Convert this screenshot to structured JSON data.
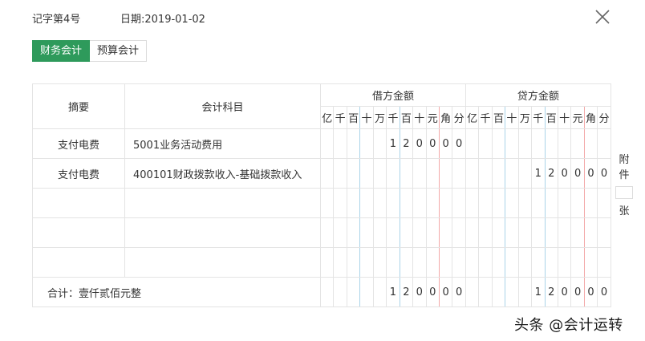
{
  "header": {
    "voucher_no": "记字第4号",
    "date": "日期:2019-01-02"
  },
  "tabs": [
    {
      "label": "财务会计",
      "active": true
    },
    {
      "label": "预算会计",
      "active": false
    }
  ],
  "table": {
    "col_summary": "摘要",
    "col_account": "会计科目",
    "debit_title": "借方金额",
    "credit_title": "贷方金额",
    "units": [
      "亿",
      "千",
      "百",
      "十",
      "万",
      "千",
      "百",
      "十",
      "元",
      "角",
      "分"
    ],
    "rows": [
      {
        "summary": "支付电费",
        "account": "5001业务活动费用",
        "debit": [
          "",
          "",
          "",
          "",
          "",
          "1",
          "2",
          "0",
          "0",
          "0",
          "0"
        ],
        "credit": [
          "",
          "",
          "",
          "",
          "",
          "",
          "",
          "",
          "",
          "",
          ""
        ]
      },
      {
        "summary": "支付电费",
        "account": "400101财政拨款收入-基础拨款收入",
        "debit": [
          "",
          "",
          "",
          "",
          "",
          "",
          "",
          "",
          "",
          "",
          ""
        ],
        "credit": [
          "",
          "",
          "",
          "",
          "",
          "1",
          "2",
          "0",
          "0",
          "0",
          "0"
        ]
      },
      {
        "summary": "",
        "account": "",
        "debit": [
          "",
          "",
          "",
          "",
          "",
          "",
          "",
          "",
          "",
          "",
          ""
        ],
        "credit": [
          "",
          "",
          "",
          "",
          "",
          "",
          "",
          "",
          "",
          "",
          ""
        ]
      },
      {
        "summary": "",
        "account": "",
        "debit": [
          "",
          "",
          "",
          "",
          "",
          "",
          "",
          "",
          "",
          "",
          ""
        ],
        "credit": [
          "",
          "",
          "",
          "",
          "",
          "",
          "",
          "",
          "",
          "",
          ""
        ]
      },
      {
        "summary": "",
        "account": "",
        "debit": [
          "",
          "",
          "",
          "",
          "",
          "",
          "",
          "",
          "",
          "",
          ""
        ],
        "credit": [
          "",
          "",
          "",
          "",
          "",
          "",
          "",
          "",
          "",
          "",
          ""
        ]
      }
    ],
    "total": {
      "label": "合计：壹仟贰佰元整",
      "debit": [
        "",
        "",
        "",
        "",
        "",
        "1",
        "2",
        "0",
        "0",
        "0",
        "0"
      ],
      "credit": [
        "",
        "",
        "",
        "",
        "",
        "1",
        "2",
        "0",
        "0",
        "0",
        "0"
      ]
    }
  },
  "attachment": {
    "char1": "附",
    "char2": "件",
    "unit": "张",
    "count": ""
  },
  "watermark": "头条 @会计运转",
  "icons": {
    "close": "close-icon"
  }
}
